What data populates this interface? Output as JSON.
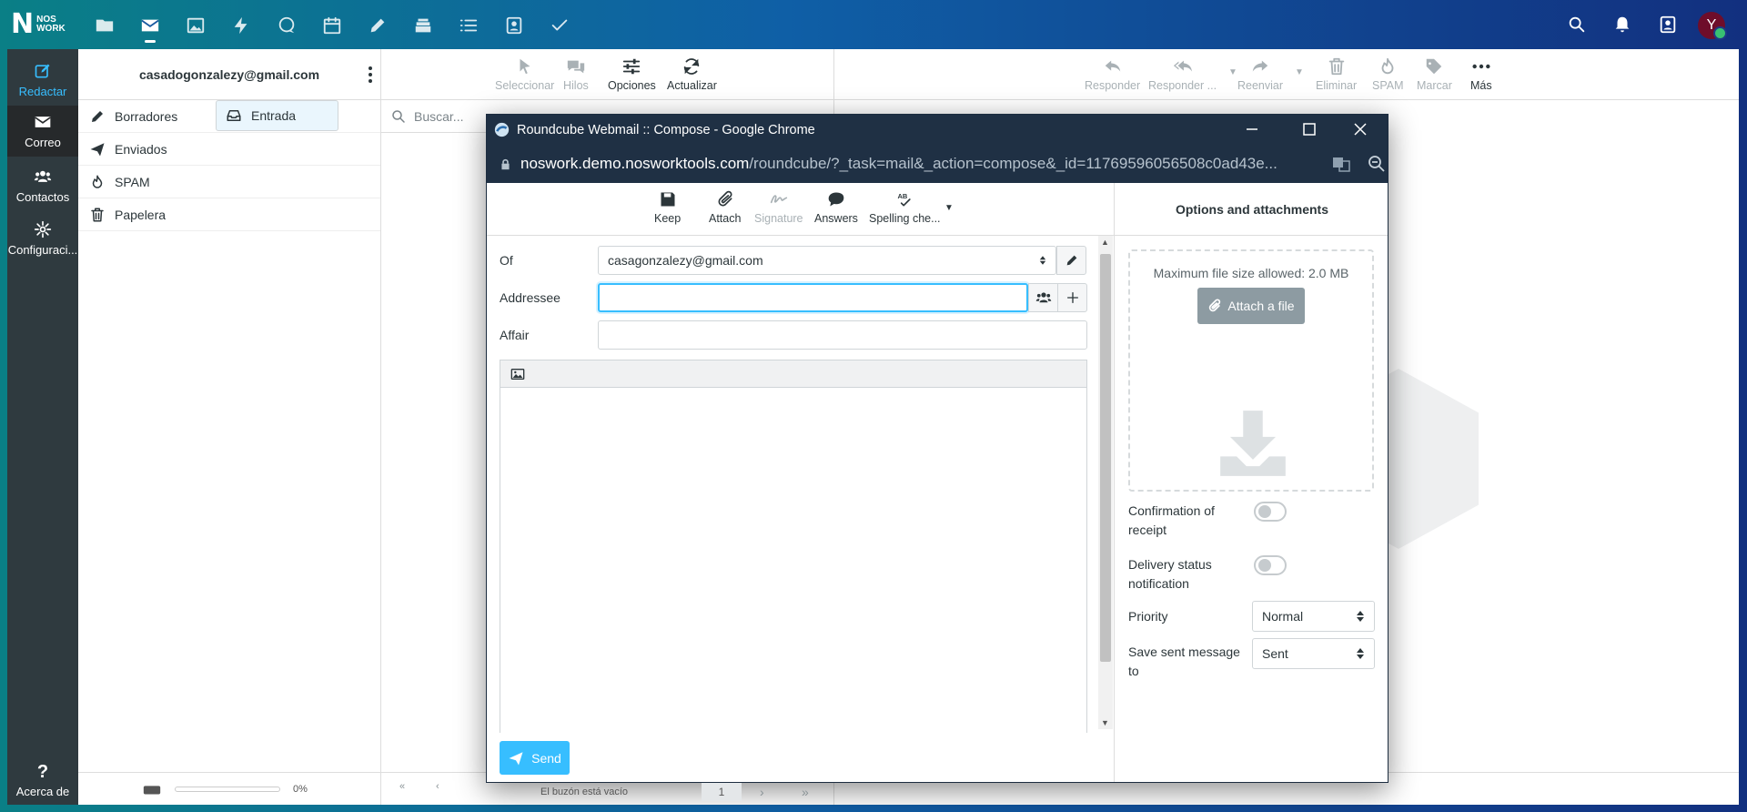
{
  "topbar": {
    "logo_line1": "NOS",
    "logo_line2": "WORK",
    "apps": [
      {
        "name": "folder-icon"
      },
      {
        "name": "mail-icon",
        "active": true
      },
      {
        "name": "image-icon"
      },
      {
        "name": "bolt-icon"
      },
      {
        "name": "chat-icon"
      },
      {
        "name": "calendar-icon"
      },
      {
        "name": "pencil-icon"
      },
      {
        "name": "stack-icon"
      },
      {
        "name": "list-icon"
      },
      {
        "name": "contact-card-icon"
      },
      {
        "name": "check-icon"
      }
    ],
    "avatar_letter": "Y"
  },
  "leftnav": {
    "compose": "Redactar",
    "mail": "Correo",
    "contacts": "Contactos",
    "settings": "Configuraci...",
    "about": "Acerca de"
  },
  "folders": {
    "account": "casadogonzalezy@gmail.com",
    "items": [
      {
        "label": "Entrada",
        "icon": "inbox-icon"
      },
      {
        "label": "Borradores",
        "icon": "pencil-icon"
      },
      {
        "label": "Enviados",
        "icon": "paper-plane-icon"
      },
      {
        "label": "SPAM",
        "icon": "fire-icon"
      },
      {
        "label": "Papelera",
        "icon": "trash-icon"
      }
    ],
    "quota": "0%",
    "quota_fraction": 0
  },
  "msglist": {
    "toolbar": {
      "select": "Seleccionar",
      "threads": "Hilos",
      "options": "Opciones",
      "refresh": "Actualizar"
    },
    "search_placeholder": "Buscar...",
    "empty": "El buzón está vacío",
    "page": "1"
  },
  "content": {
    "toolbar": {
      "reply": "Responder",
      "reply_all": "Responder ...",
      "forward": "Reenviar",
      "delete": "Eliminar",
      "spam": "SPAM",
      "mark": "Marcar",
      "more": "Más"
    }
  },
  "popup": {
    "title": "Roundcube Webmail :: Compose - Google Chrome",
    "url_host": "noswork.demo.nosworktools.com",
    "url_path": "/roundcube/?_task=mail&_action=compose&_id=11769596056508c0ad43e...",
    "toolbar": {
      "keep": "Keep",
      "attach": "Attach",
      "signature": "Signature",
      "answers": "Answers",
      "spelling": "Spelling che..."
    },
    "form": {
      "of_label": "Of",
      "of_value": "casagonzalezy@gmail.com",
      "addressee_label": "Addressee",
      "addressee_value": "",
      "affair_label": "Affair",
      "affair_value": ""
    },
    "send": "Send",
    "side": {
      "title": "Options and attachments",
      "max_size": "Maximum file size allowed: 2.0 MB",
      "attach_file": "Attach a file",
      "receipt_line1": "Confirmation of",
      "receipt_line2": "receipt",
      "dsn_line1": "Delivery status",
      "dsn_line2": "notification",
      "priority_label": "Priority",
      "priority_value": "Normal",
      "save_line1": "Save sent message",
      "save_line2": "to",
      "save_value": "Sent"
    }
  },
  "colors": {
    "accent": "#37beff",
    "nav_bg": "#2f3a3f",
    "popup_chrome": "#1f3044"
  }
}
